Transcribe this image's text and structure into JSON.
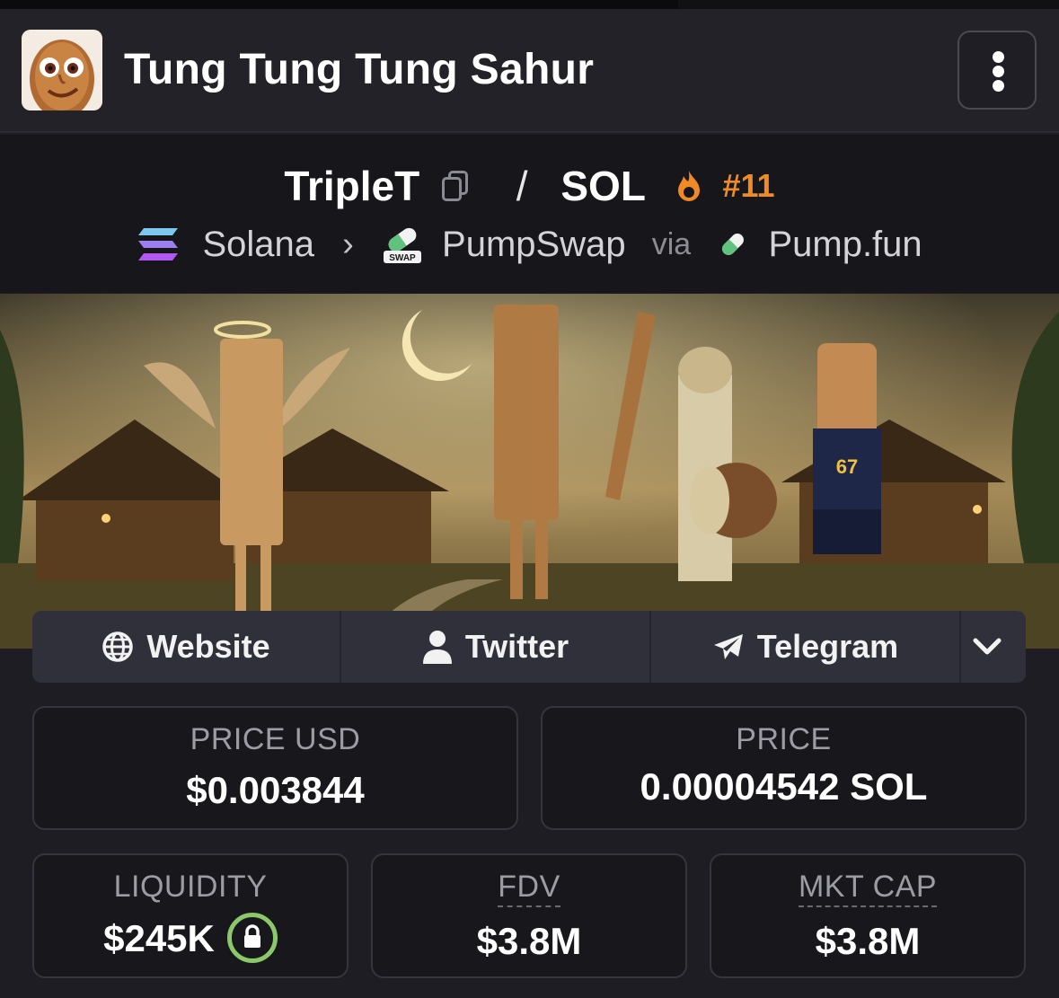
{
  "header": {
    "title": "Tung Tung Tung Sahur",
    "menu_icon": "more-vertical-icon"
  },
  "pair": {
    "base": "TripleT",
    "separator": "/",
    "quote": "SOL",
    "rank": "#11",
    "copy_icon": "copy-icon",
    "trending_icon": "fire-icon"
  },
  "breadcrumb": {
    "chain": "Solana",
    "dex": "PumpSwap",
    "via_label": "via",
    "launchpad": "Pump.fun",
    "dex_icon_text": "SWAP"
  },
  "links": {
    "website": "Website",
    "twitter": "Twitter",
    "telegram": "Telegram"
  },
  "stats": {
    "price_usd": {
      "label": "PRICE USD",
      "value": "$0.003844"
    },
    "price": {
      "label": "PRICE",
      "value": "0.00004542 SOL"
    },
    "liquidity": {
      "label": "LIQUIDITY",
      "value": "$245K"
    },
    "fdv": {
      "label": "FDV",
      "value": "$3.8M"
    },
    "mkt_cap": {
      "label": "MKT CAP",
      "value": "$3.8M"
    }
  },
  "colors": {
    "accent_orange": "#f08a24",
    "lock_green": "#8ac86a",
    "background": "#1d1d23"
  }
}
